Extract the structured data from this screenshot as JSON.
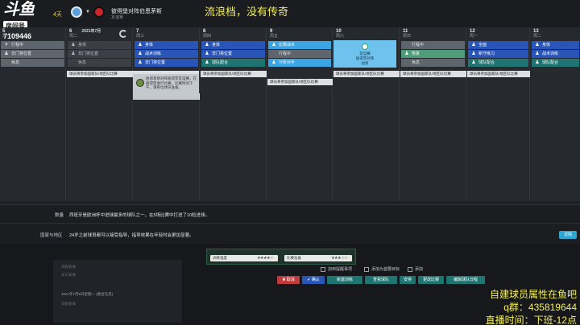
{
  "stream": {
    "logo": "斗鱼",
    "room_label": "房间号",
    "room_number": "7109446",
    "overlay_top": "流浪档，没有传奇",
    "overlay_line1": "自建球员属性在鱼吧",
    "overlay_line2": "q群：435819644",
    "overlay_line3": "直播时间：下班-12点"
  },
  "header": {
    "days_left": "4天",
    "match_title": "彼得堡对阵伯恩茅斯",
    "match_subtitle": "友谊赛"
  },
  "calendar": {
    "days": [
      {
        "num": "5",
        "name": "周一",
        "slots": [
          {
            "icon": "✈",
            "text": "行程中",
            "style": "gray"
          },
          {
            "icon": "♟",
            "text": "非门将位置",
            "style": "gray"
          },
          {
            "icon": "",
            "text": "休息",
            "style": "gray"
          }
        ]
      },
      {
        "num": "6",
        "name": "周二",
        "date_label": "2021年7月",
        "slots": [
          {
            "icon": "♟",
            "text": "身体",
            "style": "dark"
          },
          {
            "icon": "♟",
            "text": "非门将位置",
            "style": "dark"
          },
          {
            "icon": "",
            "text": "休息",
            "style": "dark"
          }
        ]
      },
      {
        "num": "7",
        "name": "周三",
        "slots": [
          {
            "icon": "♟",
            "text": "身体",
            "style": "blue"
          },
          {
            "icon": "♟",
            "text": "战术训练",
            "style": "blue"
          },
          {
            "icon": "♟",
            "text": "非门将位置",
            "style": "blue"
          }
        ]
      },
      {
        "num": "8",
        "name": "周四",
        "slots": [
          {
            "icon": "♟",
            "text": "身体",
            "style": "blue"
          },
          {
            "icon": "♟",
            "text": "非门将位置",
            "style": "blue"
          },
          {
            "icon": "♟",
            "text": "球队配合",
            "style": "teal"
          }
        ]
      },
      {
        "num": "9",
        "name": "周五",
        "slots": [
          {
            "icon": "♟",
            "text": "比赛战术",
            "style": "cyan"
          },
          {
            "icon": "",
            "text": "行程中",
            "style": "gray"
          },
          {
            "icon": "♟",
            "text": "分析对手",
            "style": "cyan"
          }
        ]
      },
      {
        "num": "10",
        "name": "周六",
        "slots": []
      },
      {
        "num": "11",
        "name": "周日",
        "slots": [
          {
            "icon": "",
            "text": "行程中",
            "style": "gray"
          },
          {
            "icon": "♟",
            "text": "恢复",
            "style": "green"
          },
          {
            "icon": "",
            "text": "休息",
            "style": "gray"
          }
        ]
      },
      {
        "num": "12",
        "name": "周一",
        "slots": [
          {
            "icon": "♟",
            "text": "全面",
            "style": "blue"
          },
          {
            "icon": "♟",
            "text": "新守练习",
            "style": "blue"
          },
          {
            "icon": "♟",
            "text": "球队配合",
            "style": "teal"
          }
        ]
      },
      {
        "num": "13",
        "name": "周二",
        "slots": [
          {
            "icon": "♟",
            "text": "身体",
            "style": "blue"
          },
          {
            "icon": "♟",
            "text": "战术训练",
            "style": "blue"
          },
          {
            "icon": "♟",
            "text": "球队配合",
            "style": "teal"
          }
        ]
      }
    ],
    "match_card": {
      "line1": "友谊赛",
      "line2": "彼得堡对阵",
      "line3": "伯恩"
    },
    "popup_text": "伯恩茅斯对阵彼得堡友谊赛，在彼得堡进行比赛，比赛时间下午，请各位球员准备。",
    "tag_text": "球员将参加国家队/地区队比赛"
  },
  "info": {
    "row1_label": "数量",
    "row1_text": "西班牙是欧洲杯中进球最多的球队之一，在5场比赛中打进了10粒进球。",
    "row2_label": "国家与地区",
    "row2_text": "24岁之前球员都可以接受指导，指导效果在年轻时会更加显著。",
    "details_button": "详情"
  },
  "lower": {
    "left_line1": "日程安排",
    "left_line2": "员工安排",
    "left_line3": "2021年7月5日星期一 (集合信息)",
    "left_line4": "日程安排",
    "rating1_label": "训练强度",
    "rating1_stars": "★★★★☆",
    "rating2_label": "比赛准备",
    "rating2_stars": "★★★☆☆",
    "chk1": "加到提醒事项",
    "chk2": "添加为首要目标",
    "chk3": "添加",
    "btn_cancel": "✖ 取消",
    "btn_confirm": "✔ 确认",
    "btn_a": "新建训练",
    "btn_b": "查看球队",
    "btn_c": "安排",
    "btn_d": "更改比赛",
    "btn_e": "编辑球队日程"
  },
  "colors": {
    "accent_blue": "#2a55b8",
    "accent_cyan": "#3ba5e3",
    "accent_teal": "#1e7470",
    "overlay_yellow": "#f4ee5a"
  }
}
